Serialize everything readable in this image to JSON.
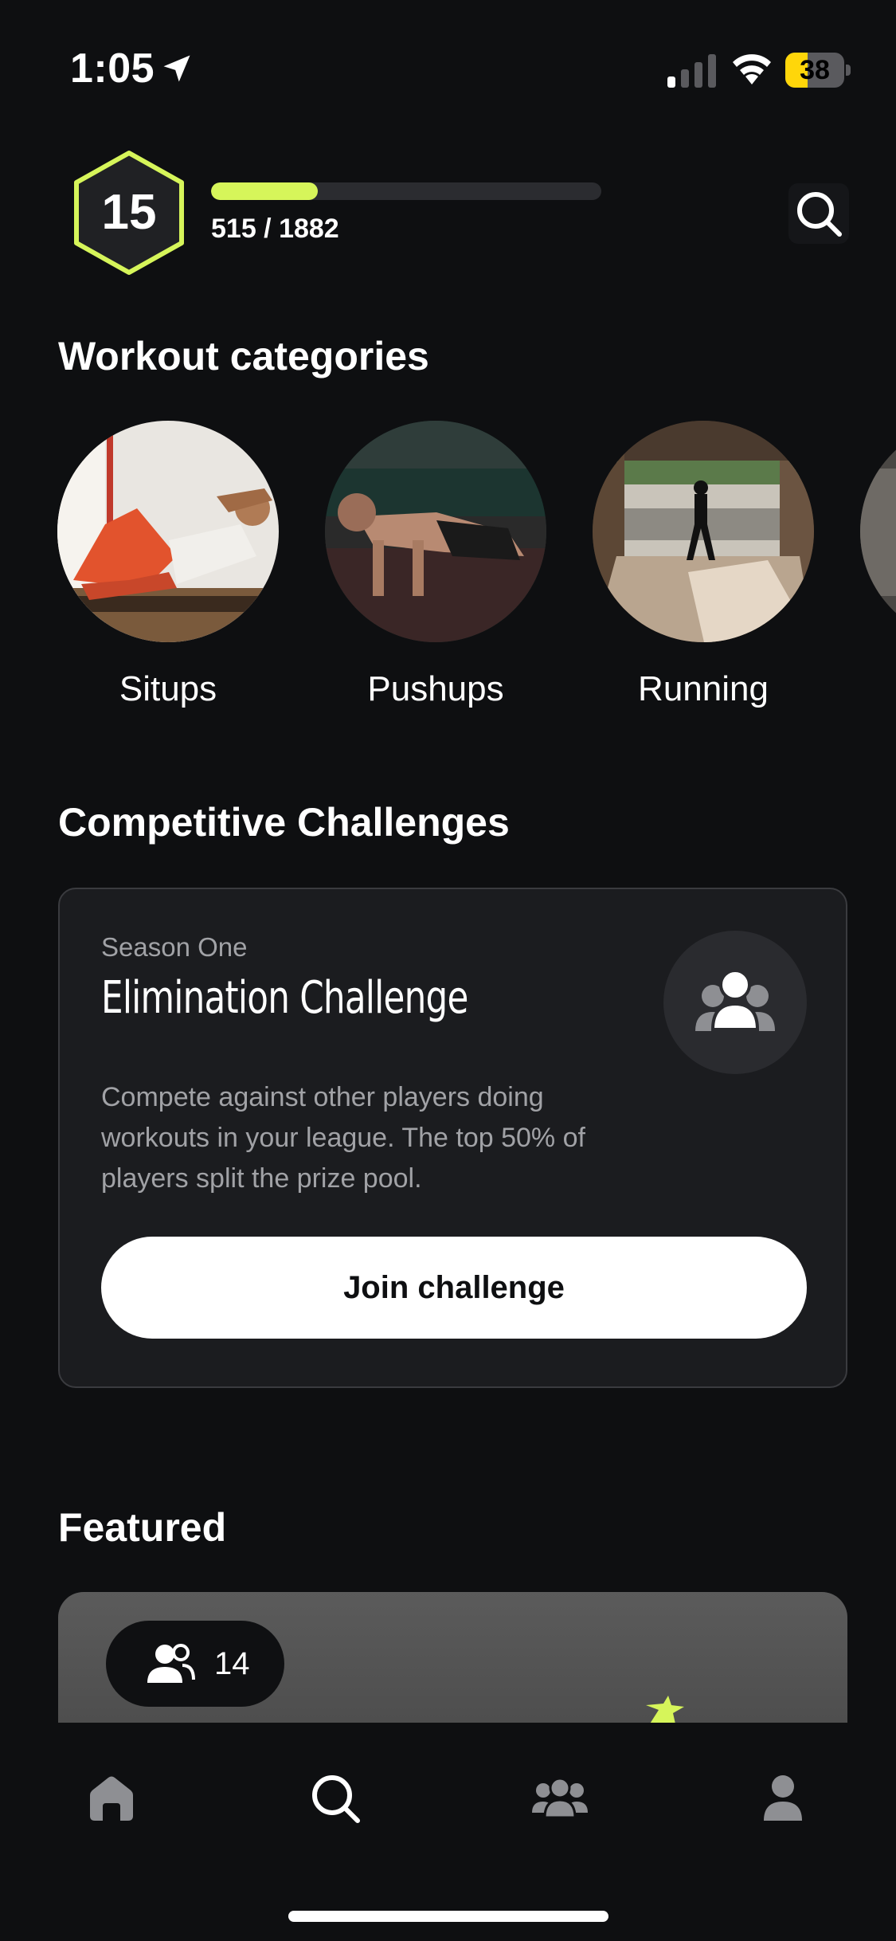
{
  "status_bar": {
    "time": "1:05",
    "battery_level": "38",
    "battery_fraction": 0.38,
    "icons": [
      "location-arrow-icon",
      "cellular-signal-icon",
      "wifi-icon",
      "battery-icon"
    ]
  },
  "header": {
    "level": "15",
    "xp_text": "515 / 1882",
    "xp_current": 515,
    "xp_total": 1882,
    "accent_color": "#d6f55a",
    "search_icon": "search-icon"
  },
  "categories": {
    "title": "Workout categories",
    "items": [
      {
        "label": "Situps",
        "icon": "situps-photo"
      },
      {
        "label": "Pushups",
        "icon": "pushups-photo"
      },
      {
        "label": "Running",
        "icon": "running-photo"
      }
    ]
  },
  "challenges": {
    "title": "Competitive Challenges",
    "card": {
      "kicker": "Season One",
      "title": "Elimination Challenge",
      "description": "Compete against other players doing workouts in your league. The top 50% of players split the prize pool.",
      "button": "Join challenge",
      "icon": "group-icon"
    }
  },
  "featured": {
    "title": "Featured",
    "participants": "14",
    "icon": "users-icon"
  },
  "tab_bar": {
    "tabs": [
      {
        "icon": "home-icon",
        "active": false
      },
      {
        "icon": "search-icon",
        "active": true
      },
      {
        "icon": "community-icon",
        "active": false
      },
      {
        "icon": "profile-icon",
        "active": false
      }
    ]
  },
  "colors": {
    "background": "#0e0f11",
    "card": "#1b1c1f",
    "accent": "#d6f55a",
    "muted_text": "#a1a2a6"
  }
}
